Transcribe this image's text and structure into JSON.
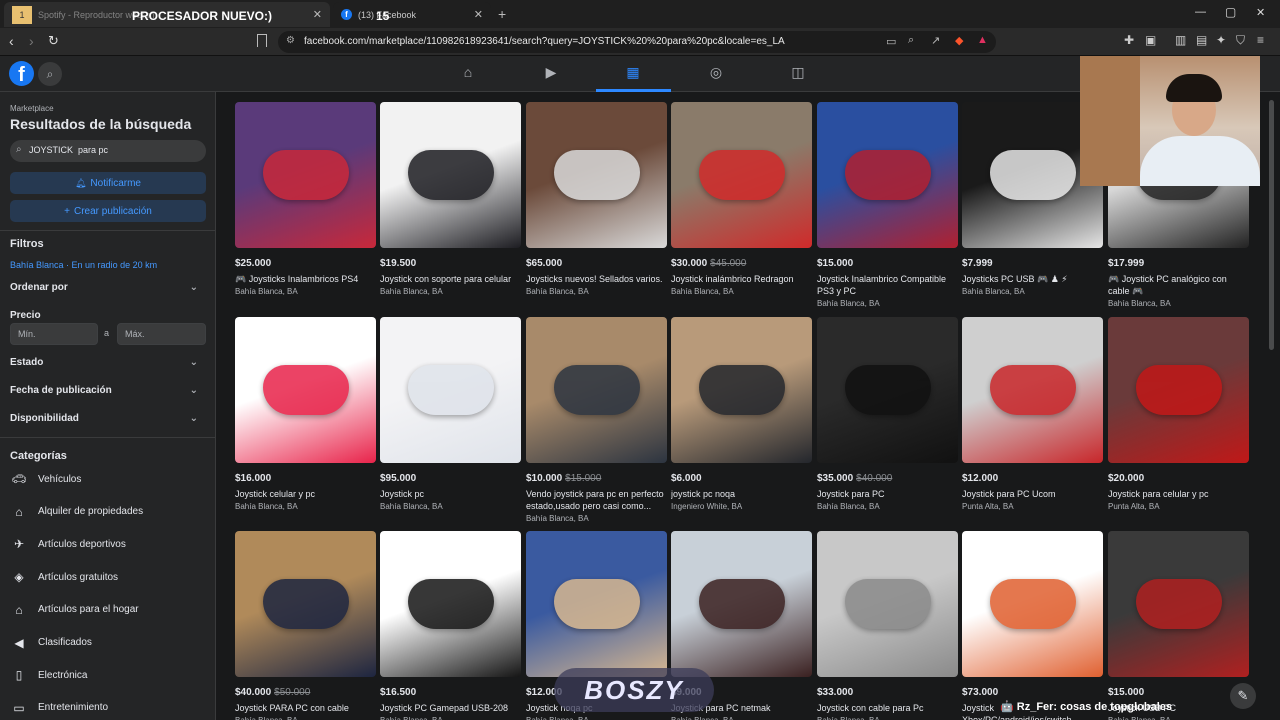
{
  "browser": {
    "tabs": [
      {
        "label": "Spotify - Reproductor web: m",
        "overlay": "PROCESADOR NUEVO:)"
      },
      {
        "label": "(13) Facebook",
        "overlay": "15"
      }
    ],
    "url": "facebook.com/marketplace/110982618923641/search?query=JOYSTICK%20%20para%20pc&locale=es_LA",
    "new_tab": "+",
    "window_min": "—",
    "window_max": "▢",
    "window_close": "✕"
  },
  "sidebar": {
    "section": "Marketplace",
    "heading": "Resultados de la búsqueda",
    "search_value": "JOYSTICK  para pc",
    "notify_label": "Notificarme",
    "create_label": "Crear publicación",
    "filters_title": "Filtros",
    "location": "Bahía Blanca · En un radio de 20 km",
    "sort_label": "Ordenar por",
    "price_label": "Precio",
    "min_placeholder": "Mín.",
    "max_placeholder": "Máx.",
    "price_sep": "a",
    "state_label": "Estado",
    "date_label": "Fecha de publicación",
    "availability_label": "Disponibilidad",
    "categories_title": "Categorías",
    "categories": [
      {
        "label": "Vehículos",
        "icon": "car-icon"
      },
      {
        "label": "Alquiler de propiedades",
        "icon": "house-icon"
      },
      {
        "label": "Artículos deportivos",
        "icon": "runner-icon"
      },
      {
        "label": "Artículos gratuitos",
        "icon": "tag-icon"
      },
      {
        "label": "Artículos para el hogar",
        "icon": "home-icon"
      },
      {
        "label": "Clasificados",
        "icon": "megaphone-icon"
      },
      {
        "label": "Electrónica",
        "icon": "phone-icon"
      },
      {
        "label": "Entretenimiento",
        "icon": "ticket-icon"
      }
    ]
  },
  "listings": [
    {
      "price": "$25.000",
      "old": "",
      "title": "🎮 Joysticks Inalambricos PS4",
      "loc": "Bahía Blanca, BA",
      "colors": [
        "#5a3a7a",
        "#c8283a"
      ]
    },
    {
      "price": "$19.500",
      "old": "",
      "title": "Joystick con soporte para celular",
      "loc": "Bahía Blanca, BA",
      "colors": [
        "#f2f2f2",
        "#1d1d22"
      ]
    },
    {
      "price": "$65.000",
      "old": "",
      "title": "Joysticks nuevos! Sellados varios.",
      "loc": "Bahía Blanca, BA",
      "colors": [
        "#6b4a3a",
        "#d9d9d9"
      ]
    },
    {
      "price": "$30.000",
      "old": "$45.000",
      "title": "Joystick inalámbrico Redragon",
      "loc": "Bahía Blanca, BA",
      "colors": [
        "#8a7b6a",
        "#d02a2a"
      ]
    },
    {
      "price": "$15.000",
      "old": "",
      "title": "Joystick Inalambrico Compatible PS3 y PC",
      "loc": "Bahía Blanca, BA",
      "colors": [
        "#2a4fa0",
        "#b02030"
      ]
    },
    {
      "price": "$7.999",
      "old": "",
      "title": "Joysticks PC USB 🎮 ♟ ⚡",
      "loc": "Bahía Blanca, BA",
      "colors": [
        "#1a1a1a",
        "#e6e6e6"
      ]
    },
    {
      "price": "$17.999",
      "old": "",
      "title": "🎮 Joystick PC analógico con cable 🎮",
      "loc": "Bahía Blanca, BA",
      "colors": [
        "#d8d8d8",
        "#222"
      ]
    },
    {
      "price": "$16.000",
      "old": "",
      "title": "Joystick celular y pc",
      "loc": "Bahía Blanca, BA",
      "colors": [
        "#ffffff",
        "#e8234a"
      ]
    },
    {
      "price": "$95.000",
      "old": "",
      "title": "Joystick pc",
      "loc": "Bahía Blanca, BA",
      "colors": [
        "#f3f3f5",
        "#dfe3ea"
      ]
    },
    {
      "price": "$10.000",
      "old": "$15.000",
      "title": "Vendo joystick para pc en perfecto estado,usado pero casi como...",
      "loc": "Bahía Blanca, BA",
      "colors": [
        "#a88a6a",
        "#2c3440"
      ]
    },
    {
      "price": "$6.000",
      "old": "",
      "title": "joystick pc noqa",
      "loc": "Ingeniero White, BA",
      "colors": [
        "#b89a7a",
        "#23262c"
      ]
    },
    {
      "price": "$35.000",
      "old": "$40.000",
      "title": "Joystick para PC",
      "loc": "Bahía Blanca, BA",
      "colors": [
        "#2a2a2a",
        "#111"
      ]
    },
    {
      "price": "$12.000",
      "old": "",
      "title": "Joystick para PC Ucom",
      "loc": "Punta Alta, BA",
      "colors": [
        "#cfcfcf",
        "#c8262a"
      ]
    },
    {
      "price": "$20.000",
      "old": "",
      "title": "Joystick para celular y pc",
      "loc": "Punta Alta, BA",
      "colors": [
        "#6a3a3a",
        "#c01818"
      ]
    },
    {
      "price": "$40.000",
      "old": "$50.000",
      "title": "Joystick PARA PC con cable",
      "loc": "Bahía Blanca, BA",
      "colors": [
        "#b08a5a",
        "#1d2540"
      ]
    },
    {
      "price": "$16.500",
      "old": "",
      "title": "Joystick PC Gamepad USB-208",
      "loc": "Bahía Blanca, BA",
      "colors": [
        "#ffffff",
        "#151515"
      ]
    },
    {
      "price": "$12.000",
      "old": "",
      "title": "Joystick noqa pc",
      "loc": "Bahía Blanca, BA",
      "colors": [
        "#3a5aa0",
        "#d8b890"
      ]
    },
    {
      "price": "$9.000",
      "old": "",
      "title": "Joystick para PC netmak",
      "loc": "Bahía Blanca, BA",
      "colors": [
        "#c8d0d8",
        "#3a2020"
      ]
    },
    {
      "price": "$33.000",
      "old": "",
      "title": "Joystick con cable para Pc",
      "loc": "Bahía Blanca, BA",
      "colors": [
        "#c8c8c8",
        "#8a8a8a"
      ]
    },
    {
      "price": "$73.000",
      "old": "",
      "title": "Joystick Xbox/PC/android/ios/switch",
      "loc": "Bahía Blanca, BA",
      "colors": [
        "#ffffff",
        "#e06030"
      ]
    },
    {
      "price": "$15.000",
      "old": "",
      "title": "Joystick USB PC",
      "loc": "Bahía Blanca, BA",
      "colors": [
        "#3a3a3a",
        "#b02020"
      ]
    }
  ],
  "overlays": {
    "logo_text": "BOSZY",
    "ticker": "🤖 Rz_Fer: cosas de topglobales",
    "webcam": "webcam"
  }
}
